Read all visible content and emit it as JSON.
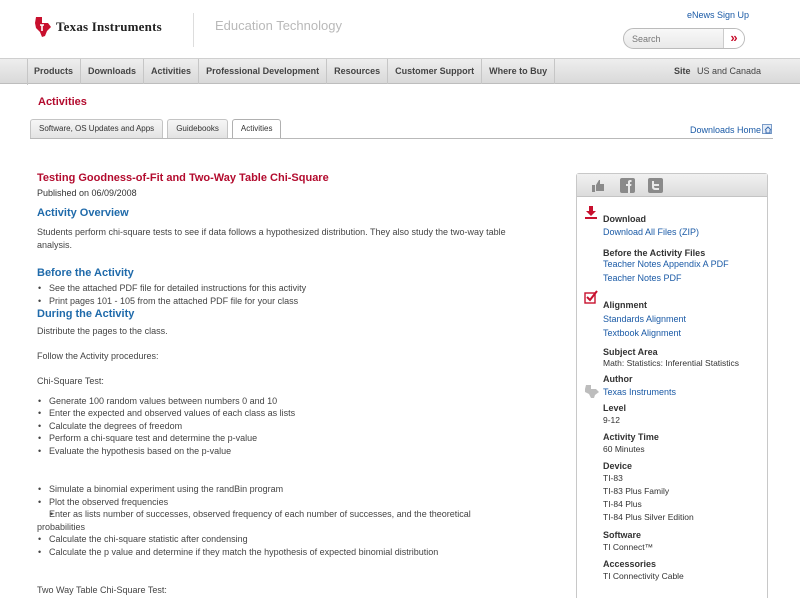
{
  "header": {
    "brand": "Texas Instruments",
    "tagline": "Education Technology",
    "enews_link": "eNews Sign Up",
    "search_placeholder": "Search",
    "search_button": "»"
  },
  "nav": {
    "items": [
      "Products",
      "Downloads",
      "Activities",
      "Professional Development",
      "Resources",
      "Customer Support",
      "Where to Buy"
    ],
    "site_label": "Site",
    "site_value": "US and Canada"
  },
  "section_title": "Activities",
  "tabs": {
    "items": [
      "Software, OS Updates and Apps",
      "Guidebooks",
      "Activities"
    ],
    "active_index": 2,
    "downloads_home": "Downloads Home"
  },
  "activity": {
    "title": "Testing Goodness-of-Fit and Two-Way Table Chi-Square",
    "published": "Published on 06/09/2008",
    "overview_heading": "Activity Overview",
    "overview_text": "Students perform chi-square tests to see if data follows a hypothesized distribution. They also study the two-way table analysis.",
    "before_heading": "Before the Activity",
    "before_items": [
      "See the attached PDF file for detailed instructions for this activity",
      "Print pages 101 - 105 from the attached PDF file for your class"
    ],
    "during_heading": "During the Activity",
    "during_text_1": "Distribute the pages to the class.",
    "during_text_2": "Follow the Activity procedures:",
    "chi_square_heading": "Chi-Square Test:",
    "chi_items_1": [
      "Generate 100 random values between numbers 0 and 10",
      "Enter the expected and observed values of each class as lists",
      "Calculate the degrees of freedom",
      "Perform a chi-square test and determine the p-value",
      "Evaluate the hypothesis based on the p-value"
    ],
    "chi_items_2": [
      "Simulate a binomial experiment using the randBin program",
      "Plot the observed frequencies",
      "Enter as lists number of successes, observed frequency of each number of successes, and the theoretical probabilities",
      "Calculate the chi-square statistic after condensing",
      "Calculate the p value and determine if they match the hypothesis of expected binomial distribution"
    ],
    "two_way_heading": "Two Way Table Chi-Square Test:"
  },
  "sidebar": {
    "share_icons": [
      "thumbs-up-icon",
      "facebook-icon",
      "twitter-icon"
    ],
    "download_heading": "Download",
    "download_all": "Download All Files (ZIP)",
    "before_files_heading": "Before the Activity Files",
    "before_files": [
      "Teacher Notes Appendix A PDF",
      "Teacher Notes PDF"
    ],
    "alignment_heading": "Alignment",
    "alignment_links": [
      "Standards Alignment",
      "Textbook Alignment"
    ],
    "subject_heading": "Subject Area",
    "subject_value": "Math: Statistics: Inferential Statistics",
    "author_heading": "Author",
    "author_value": "Texas Instruments",
    "level_heading": "Level",
    "level_value": "9-12",
    "time_heading": "Activity Time",
    "time_value": "60 Minutes",
    "device_heading": "Device",
    "devices": [
      "TI-83",
      "TI-83 Plus Family",
      "TI-84 Plus",
      "TI-84 Plus Silver Edition"
    ],
    "software_heading": "Software",
    "software_value": "TI Connect™",
    "accessories_heading": "Accessories",
    "accessories_value": "TI Connectivity Cable"
  },
  "colors": {
    "ti_red": "#c8102e",
    "heading_red": "#b30b2e",
    "heading_blue": "#1f6aaa",
    "link_blue": "#1a5aa6"
  }
}
